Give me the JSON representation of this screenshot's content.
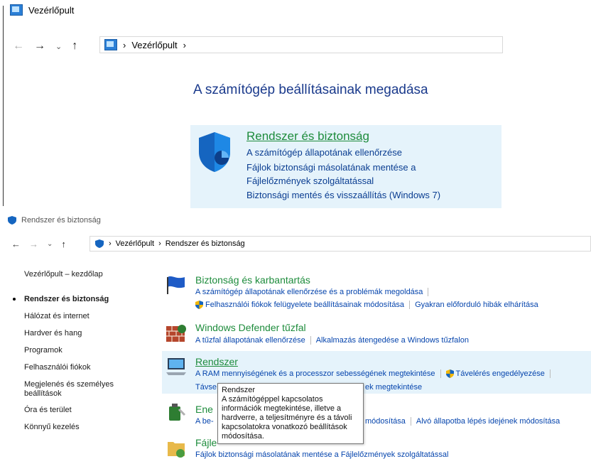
{
  "window1": {
    "title": "Vezérlőpult",
    "breadcrumb": [
      "Vezérlőpult"
    ],
    "heading": "A számítógép beállításainak megadása",
    "category": {
      "title": "Rendszer és biztonság",
      "links": [
        "A számítógép állapotának ellenőrzése",
        "Fájlok biztonsági másolatának mentése a",
        "Fájlelőzmények szolgáltatással",
        "Biztonsági mentés és visszaállítás (Windows 7)"
      ]
    }
  },
  "window2": {
    "title": "Rendszer és biztonság",
    "breadcrumb": [
      "Vezérlőpult",
      "Rendszer és biztonság"
    ],
    "sidebar": {
      "home": "Vezérlőpult – kezdőlap",
      "items": [
        "Rendszer és biztonság",
        "Hálózat és internet",
        "Hardver és hang",
        "Programok",
        "Felhasználói fiókok",
        "Megjelenés és személyes",
        "beállítások",
        "Óra és terület",
        "Könnyű kezelés"
      ]
    },
    "sections": [
      {
        "title": "Biztonság és karbantartás",
        "line1": [
          "A számítógép állapotának ellenőrzése és a problémák megoldása"
        ],
        "line2": [
          "Felhasználói fiókok felügyelete beállításainak módosítása",
          "Gyakran előforduló hibák elhárítása"
        ]
      },
      {
        "title": "Windows Defender tűzfal",
        "line1": [
          "A tűzfal állapotának ellenőrzése",
          "Alkalmazás átengedése a Windows tűzfalon"
        ]
      },
      {
        "title": "Rendszer",
        "line1": [
          "A RAM mennyiségének és a processzor sebességének megtekintése",
          "Távelérés engedélyezése"
        ],
        "line2_left": "Távse",
        "line2_right": "ek megtekintése"
      },
      {
        "title": "Ene",
        "line1_left": "A be-",
        "line1_rest": [
          "módosítása",
          "Alvó állapotba lépés idejének módosítása"
        ]
      },
      {
        "title": "Fájle",
        "line1": "Fájlok biztonsági másolatának mentése a Fájlelőzmények szolgáltatással"
      }
    ],
    "tooltip": {
      "title": "Rendszer",
      "body": "A számítógéppel kapcsolatos információk megtekintése, illetve a hardverre, a teljesítményre és a távoli kapcsolatokra vonatkozó beállítások módosítása."
    }
  },
  "icons": {
    "nav": [
      "back-arrow-icon",
      "forward-arrow-icon",
      "chevron-down-icon",
      "up-arrow-icon"
    ]
  }
}
